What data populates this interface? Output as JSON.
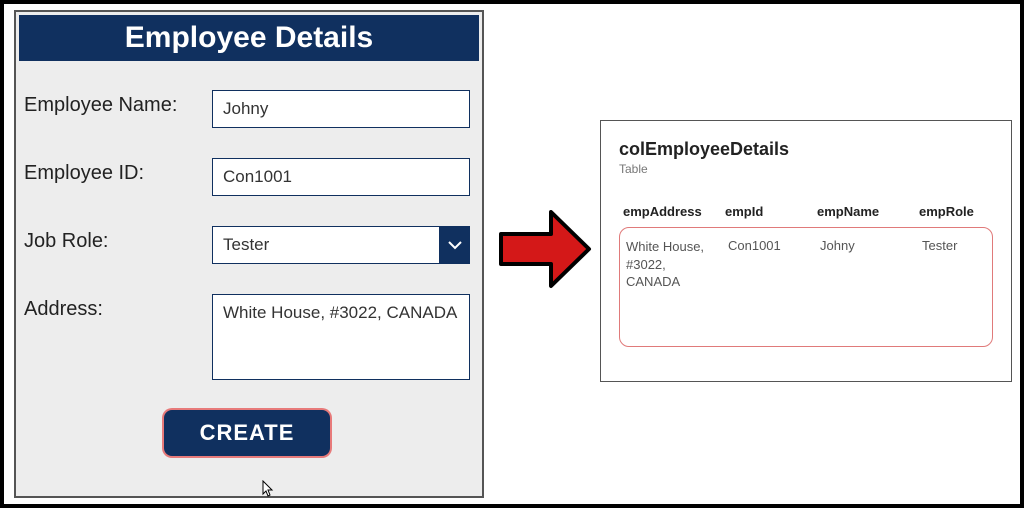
{
  "form": {
    "title": "Employee Details",
    "labels": {
      "name": "Employee Name:",
      "id": "Employee ID:",
      "role": "Job Role:",
      "address": "Address:"
    },
    "values": {
      "name": "Johny",
      "id": "Con1001",
      "role": "Tester",
      "address": "White House, #3022, CANADA"
    },
    "create_label": "CREATE"
  },
  "table_panel": {
    "title": "colEmployeeDetails",
    "subtitle": "Table",
    "headers": {
      "address": "empAddress",
      "id": "empId",
      "name": "empName",
      "role": "empRole"
    },
    "row": {
      "address": "White House,\n#3022,\nCANADA",
      "id": "Con1001",
      "name": "Johny",
      "role": "Tester"
    }
  }
}
